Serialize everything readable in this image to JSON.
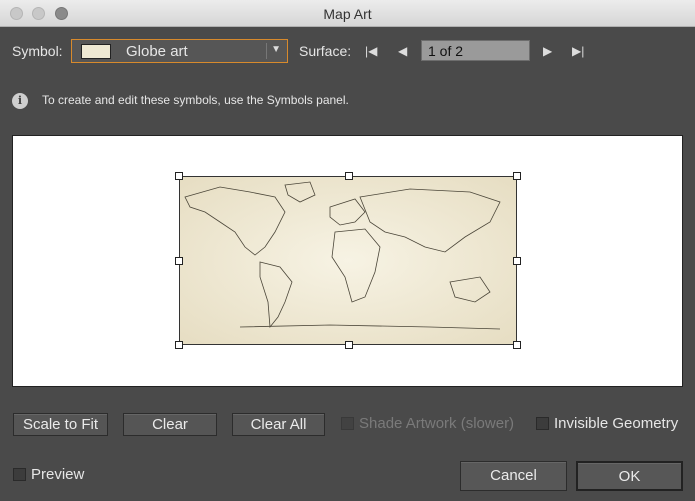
{
  "window": {
    "title": "Map Art"
  },
  "symbol": {
    "label": "Symbol:",
    "value": "Globe art",
    "accent": "#d88a2c"
  },
  "surface": {
    "label": "Surface:",
    "value": "1 of 2"
  },
  "info": {
    "text": "To create and edit these symbols, use the Symbols panel."
  },
  "buttons": {
    "scale_to_fit": "Scale to Fit",
    "clear": "Clear",
    "clear_all": "Clear All",
    "cancel": "Cancel",
    "ok": "OK"
  },
  "options": {
    "shade_artwork": {
      "label": "Shade Artwork (slower)",
      "checked": false,
      "disabled": true
    },
    "invisible_geometry": {
      "label": "Invisible Geometry",
      "checked": false
    },
    "preview": {
      "label": "Preview",
      "checked": false
    }
  }
}
